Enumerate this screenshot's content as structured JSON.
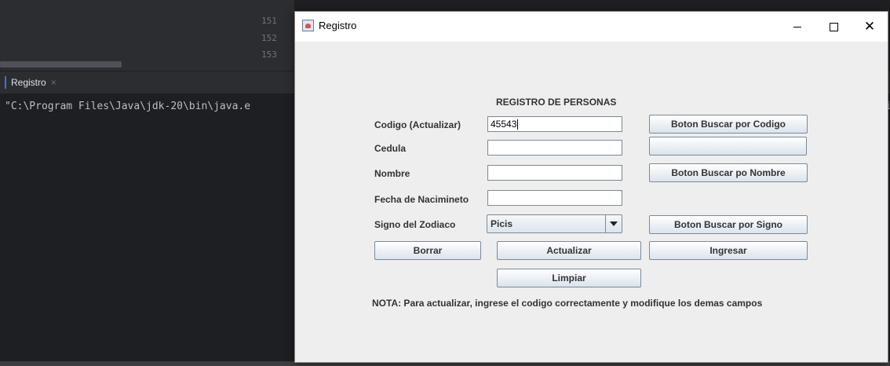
{
  "ide": {
    "line_numbers": [
      "151",
      "152",
      "153"
    ],
    "run_tab_label": "Registro",
    "run_tab_close": "×",
    "console_line": "\"C:\\Program Files\\Java\\jdk-20\\bin\\java.e",
    "console_right": "i"
  },
  "window": {
    "title": "Registro",
    "minimize": "",
    "maximize": "",
    "close": "✕"
  },
  "form": {
    "heading": "REGISTRO DE PERSONAS",
    "fields": {
      "codigo": {
        "label": "Codigo (Actualizar)",
        "value": "45543"
      },
      "cedula": {
        "label": "Cedula",
        "value": ""
      },
      "nombre": {
        "label": "Nombre",
        "value": ""
      },
      "fecha": {
        "label": "Fecha de Nacimineto",
        "value": ""
      },
      "signo": {
        "label": "Signo del Zodiaco",
        "selected": "Picis"
      }
    },
    "buttons": {
      "buscar_codigo": "Boton Buscar por Codigo",
      "buscar_nombre": "Boton Buscar po Nombre",
      "buscar_signo": "Boton Buscar por Signo",
      "borrar": "Borrar",
      "actualizar": "Actualizar",
      "ingresar": "Ingresar",
      "limpiar": "Limpiar"
    },
    "nota": "NOTA: Para actualizar, ingrese el codigo correctamente y modifique los demas campos"
  }
}
